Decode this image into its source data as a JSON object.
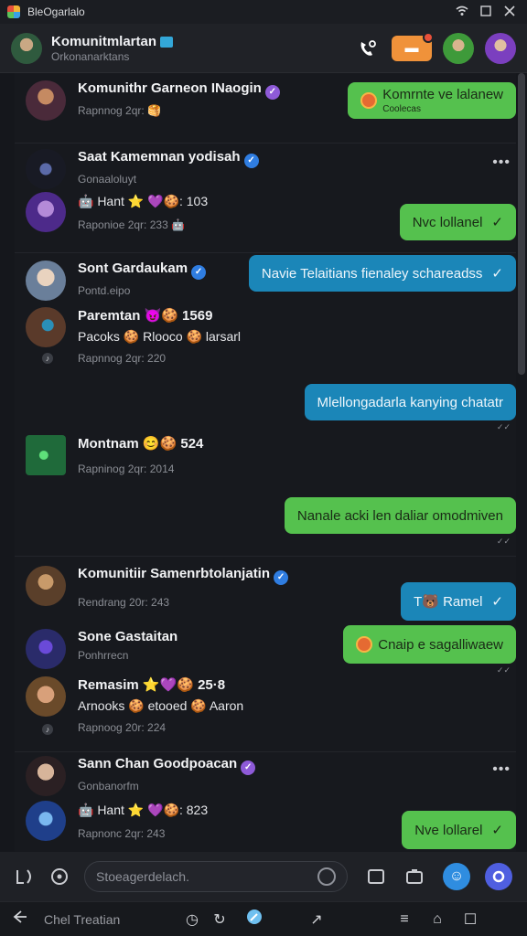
{
  "titlebar": {
    "title": "BleOgarlalo",
    "icons": [
      "wifi-icon",
      "restore-icon",
      "close-icon"
    ]
  },
  "header": {
    "name": "Komunitmlartan",
    "subtitle": "Orkonanarktans"
  },
  "feed": {
    "items": [
      {
        "name": "Komunithr Garneon INaogin",
        "badge": "purple",
        "meta": "Rapnnog 2qr: 🥞",
        "bubble": {
          "text": "Komrnte ve lalanew",
          "sub": "Coolecas",
          "color": "green",
          "emoji": true,
          "check": false
        }
      },
      {
        "name": "Saat Kamemnan yodisah",
        "badge": "blue",
        "meta": "Gonaaloluyt",
        "more": "•••"
      },
      {
        "name": "",
        "line2": "🤖 Hant ⭐ 💜🍪: 103",
        "meta": "Raponioe 2qr: 233 🤖",
        "bubble": {
          "text": "Nvc lollanel",
          "color": "green",
          "check": true
        }
      },
      {
        "name": "Sont Gardaukam",
        "badge": "blue",
        "meta": "Pontd.eipo",
        "bubble": {
          "text": "Navie Telaitians fienaley schareadss",
          "color": "blue",
          "check": true
        }
      },
      {
        "name": "Paremtan 😈🍪 1569",
        "line2": "Pacoks 🍪 Rlooco 🍪 larsarl",
        "meta": "Rapnnog 2qr: 220"
      },
      {
        "bubble": {
          "text": "Mlellongadarla kanying chatatr",
          "color": "blue",
          "check": false
        }
      },
      {
        "name": "Montnam 😊🍪 524",
        "meta": "Rapninog 2qr: 2014"
      },
      {
        "bubble": {
          "text": "Nanale acki len daliar omodmiven",
          "color": "green",
          "check": false
        }
      },
      {
        "name": "Komunitiir Samenrbtolanjatin",
        "badge": "blue",
        "meta": "Rendrang 20r: 243",
        "bubble": {
          "text": "T🐻 Ramel",
          "color": "blue",
          "check": true
        }
      },
      {
        "name": "Sone Gastaitan",
        "meta": "Ponhrrecn",
        "bubble": {
          "text": "Cnaip e sagalliwaew",
          "color": "green",
          "emoji": true,
          "check": false
        }
      },
      {
        "name": "Remasim ⭐💜🍪 25·8",
        "line2": "Arnooks 🍪 etooed 🍪 Aaron",
        "meta": "Rapnoog 20r: 224"
      },
      {
        "name": "Sann Chan Goodpoacan",
        "badge": "purple",
        "meta": "Gonbanorfm",
        "more": "•••"
      },
      {
        "name": "",
        "line2": "🤖 Hant ⭐ 💜🍪: 823",
        "meta": "Rapnonc 2qr: 243",
        "bubble": {
          "text": "Nve lollarel",
          "color": "green",
          "check": true
        }
      }
    ]
  },
  "composer": {
    "placeholder": "Stoeagerdelach."
  },
  "navbar": {
    "label": "Chel Treatian"
  },
  "colors": {
    "green": "#55c14e",
    "blue": "#1b86b8",
    "accent": "#4f5fe0"
  }
}
